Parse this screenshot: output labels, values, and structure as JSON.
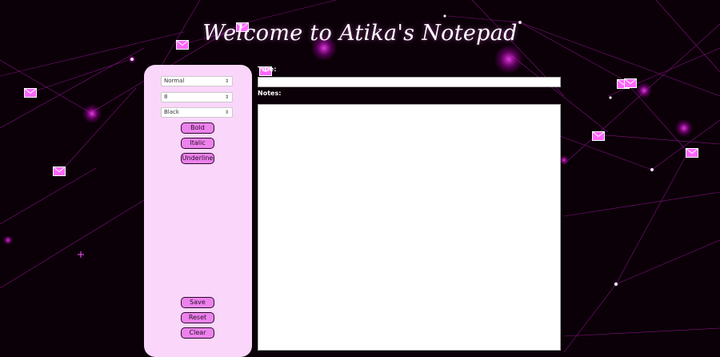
{
  "header": {
    "title": "Welcome to Atika's Notepad"
  },
  "sidebar": {
    "style_select": {
      "value": "Normal"
    },
    "size_select": {
      "value": "8"
    },
    "color_select": {
      "value": "Black"
    },
    "format_buttons": {
      "bold": "Bold",
      "italic": "Italic",
      "underline": "Underline"
    },
    "action_buttons": {
      "save": "Save",
      "reset": "Reset",
      "clear": "Clear"
    }
  },
  "editor": {
    "title_label": "Title:",
    "title_value": "",
    "notes_label": "Notes:",
    "notes_value": ""
  },
  "theme": {
    "background": "#0b0008",
    "glow": "#ff2bff",
    "panel": "#fbd6fb",
    "button": "#ec82ec"
  },
  "background_decor": {
    "icons": "envelope-icon"
  }
}
